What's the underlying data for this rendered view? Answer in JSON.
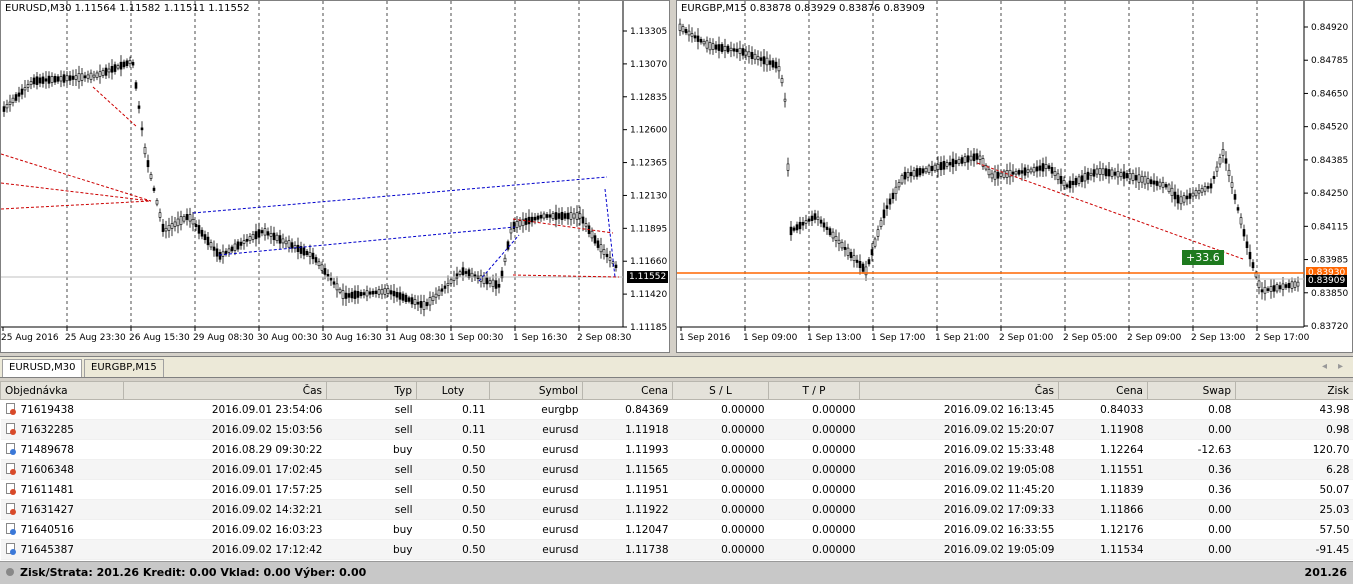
{
  "charts": {
    "left": {
      "title": "EURUSD,M30  1.11564 1.11582 1.11511 1.11552",
      "price_labels": [
        "1.13305",
        "1.13070",
        "1.12835",
        "1.12600",
        "1.12365",
        "1.12130",
        "1.11895",
        "1.11660",
        "1.11420",
        "1.11185"
      ],
      "current_price": "1.11552",
      "time_labels": [
        "25 Aug 2016",
        "25 Aug 23:30",
        "26 Aug 15:30",
        "29 Aug 08:30",
        "30 Aug 00:30",
        "30 Aug 16:30",
        "31 Aug 08:30",
        "1 Sep 00:30",
        "1 Sep 16:30",
        "2 Sep 08:30"
      ],
      "colors": {
        "bull_bear": "#000000",
        "buy_line": "#0000cc",
        "sell_line": "#cc0000",
        "price_line": "#c0c0c0"
      }
    },
    "right": {
      "title": "EURGBP,M15  0.83878 0.83929 0.83876 0.83909",
      "price_labels": [
        "0.84920",
        "0.84785",
        "0.84650",
        "0.84520",
        "0.84385",
        "0.84250",
        "0.84115",
        "0.83985",
        "0.83850",
        "0.83720"
      ],
      "current_price": "0.83909",
      "ask_price": "0.83930",
      "profit_badge": "+33.6",
      "time_labels": [
        "1 Sep 2016",
        "1 Sep 09:00",
        "1 Sep 13:00",
        "1 Sep 17:00",
        "1 Sep 21:00",
        "2 Sep 01:00",
        "2 Sep 05:00",
        "2 Sep 09:00",
        "2 Sep 13:00",
        "2 Sep 17:00"
      ],
      "colors": {
        "ask_line": "#ff6600",
        "badge": "#1e7a1e"
      }
    }
  },
  "tabs": [
    {
      "label": "EURUSD,M30",
      "active": true
    },
    {
      "label": "EURGBP,M15",
      "active": false
    }
  ],
  "table": {
    "headers": [
      "Objednávka",
      "Čas",
      "Typ",
      "Loty",
      "Symbol",
      "Cena",
      "S / L",
      "T / P",
      "Čas",
      "Cena",
      "Swap",
      "Zisk"
    ],
    "rows": [
      [
        "71619438",
        "2016.09.01 23:54:06",
        "sell",
        "0.11",
        "eurgbp",
        "0.84369",
        "0.00000",
        "0.00000",
        "2016.09.02 16:13:45",
        "0.84033",
        "0.08",
        "43.98"
      ],
      [
        "71632285",
        "2016.09.02 15:03:56",
        "sell",
        "0.11",
        "eurusd",
        "1.11918",
        "0.00000",
        "0.00000",
        "2016.09.02 15:20:07",
        "1.11908",
        "0.00",
        "0.98"
      ],
      [
        "71489678",
        "2016.08.29 09:30:22",
        "buy",
        "0.50",
        "eurusd",
        "1.11993",
        "0.00000",
        "0.00000",
        "2016.09.02 15:33:48",
        "1.12264",
        "-12.63",
        "120.70"
      ],
      [
        "71606348",
        "2016.09.01 17:02:45",
        "sell",
        "0.50",
        "eurusd",
        "1.11565",
        "0.00000",
        "0.00000",
        "2016.09.02 19:05:08",
        "1.11551",
        "0.36",
        "6.28"
      ],
      [
        "71611481",
        "2016.09.01 17:57:25",
        "sell",
        "0.50",
        "eurusd",
        "1.11951",
        "0.00000",
        "0.00000",
        "2016.09.02 11:45:20",
        "1.11839",
        "0.36",
        "50.07"
      ],
      [
        "71631427",
        "2016.09.02 14:32:21",
        "sell",
        "0.50",
        "eurusd",
        "1.11922",
        "0.00000",
        "0.00000",
        "2016.09.02 17:09:33",
        "1.11866",
        "0.00",
        "25.03"
      ],
      [
        "71640516",
        "2016.09.02 16:03:23",
        "buy",
        "0.50",
        "eurusd",
        "1.12047",
        "0.00000",
        "0.00000",
        "2016.09.02 16:33:55",
        "1.12176",
        "0.00",
        "57.50"
      ],
      [
        "71645387",
        "2016.09.02 17:12:42",
        "buy",
        "0.50",
        "eurusd",
        "1.11738",
        "0.00000",
        "0.00000",
        "2016.09.02 19:05:09",
        "1.11534",
        "0.00",
        "-91.45"
      ]
    ]
  },
  "summary": {
    "text": "Zisk/Strata: 201.26  Kredit: 0.00  Vklad: 0.00  Výber: 0.00",
    "total": "201.26"
  },
  "nav": {
    "prev": "◂",
    "next": "▸"
  }
}
